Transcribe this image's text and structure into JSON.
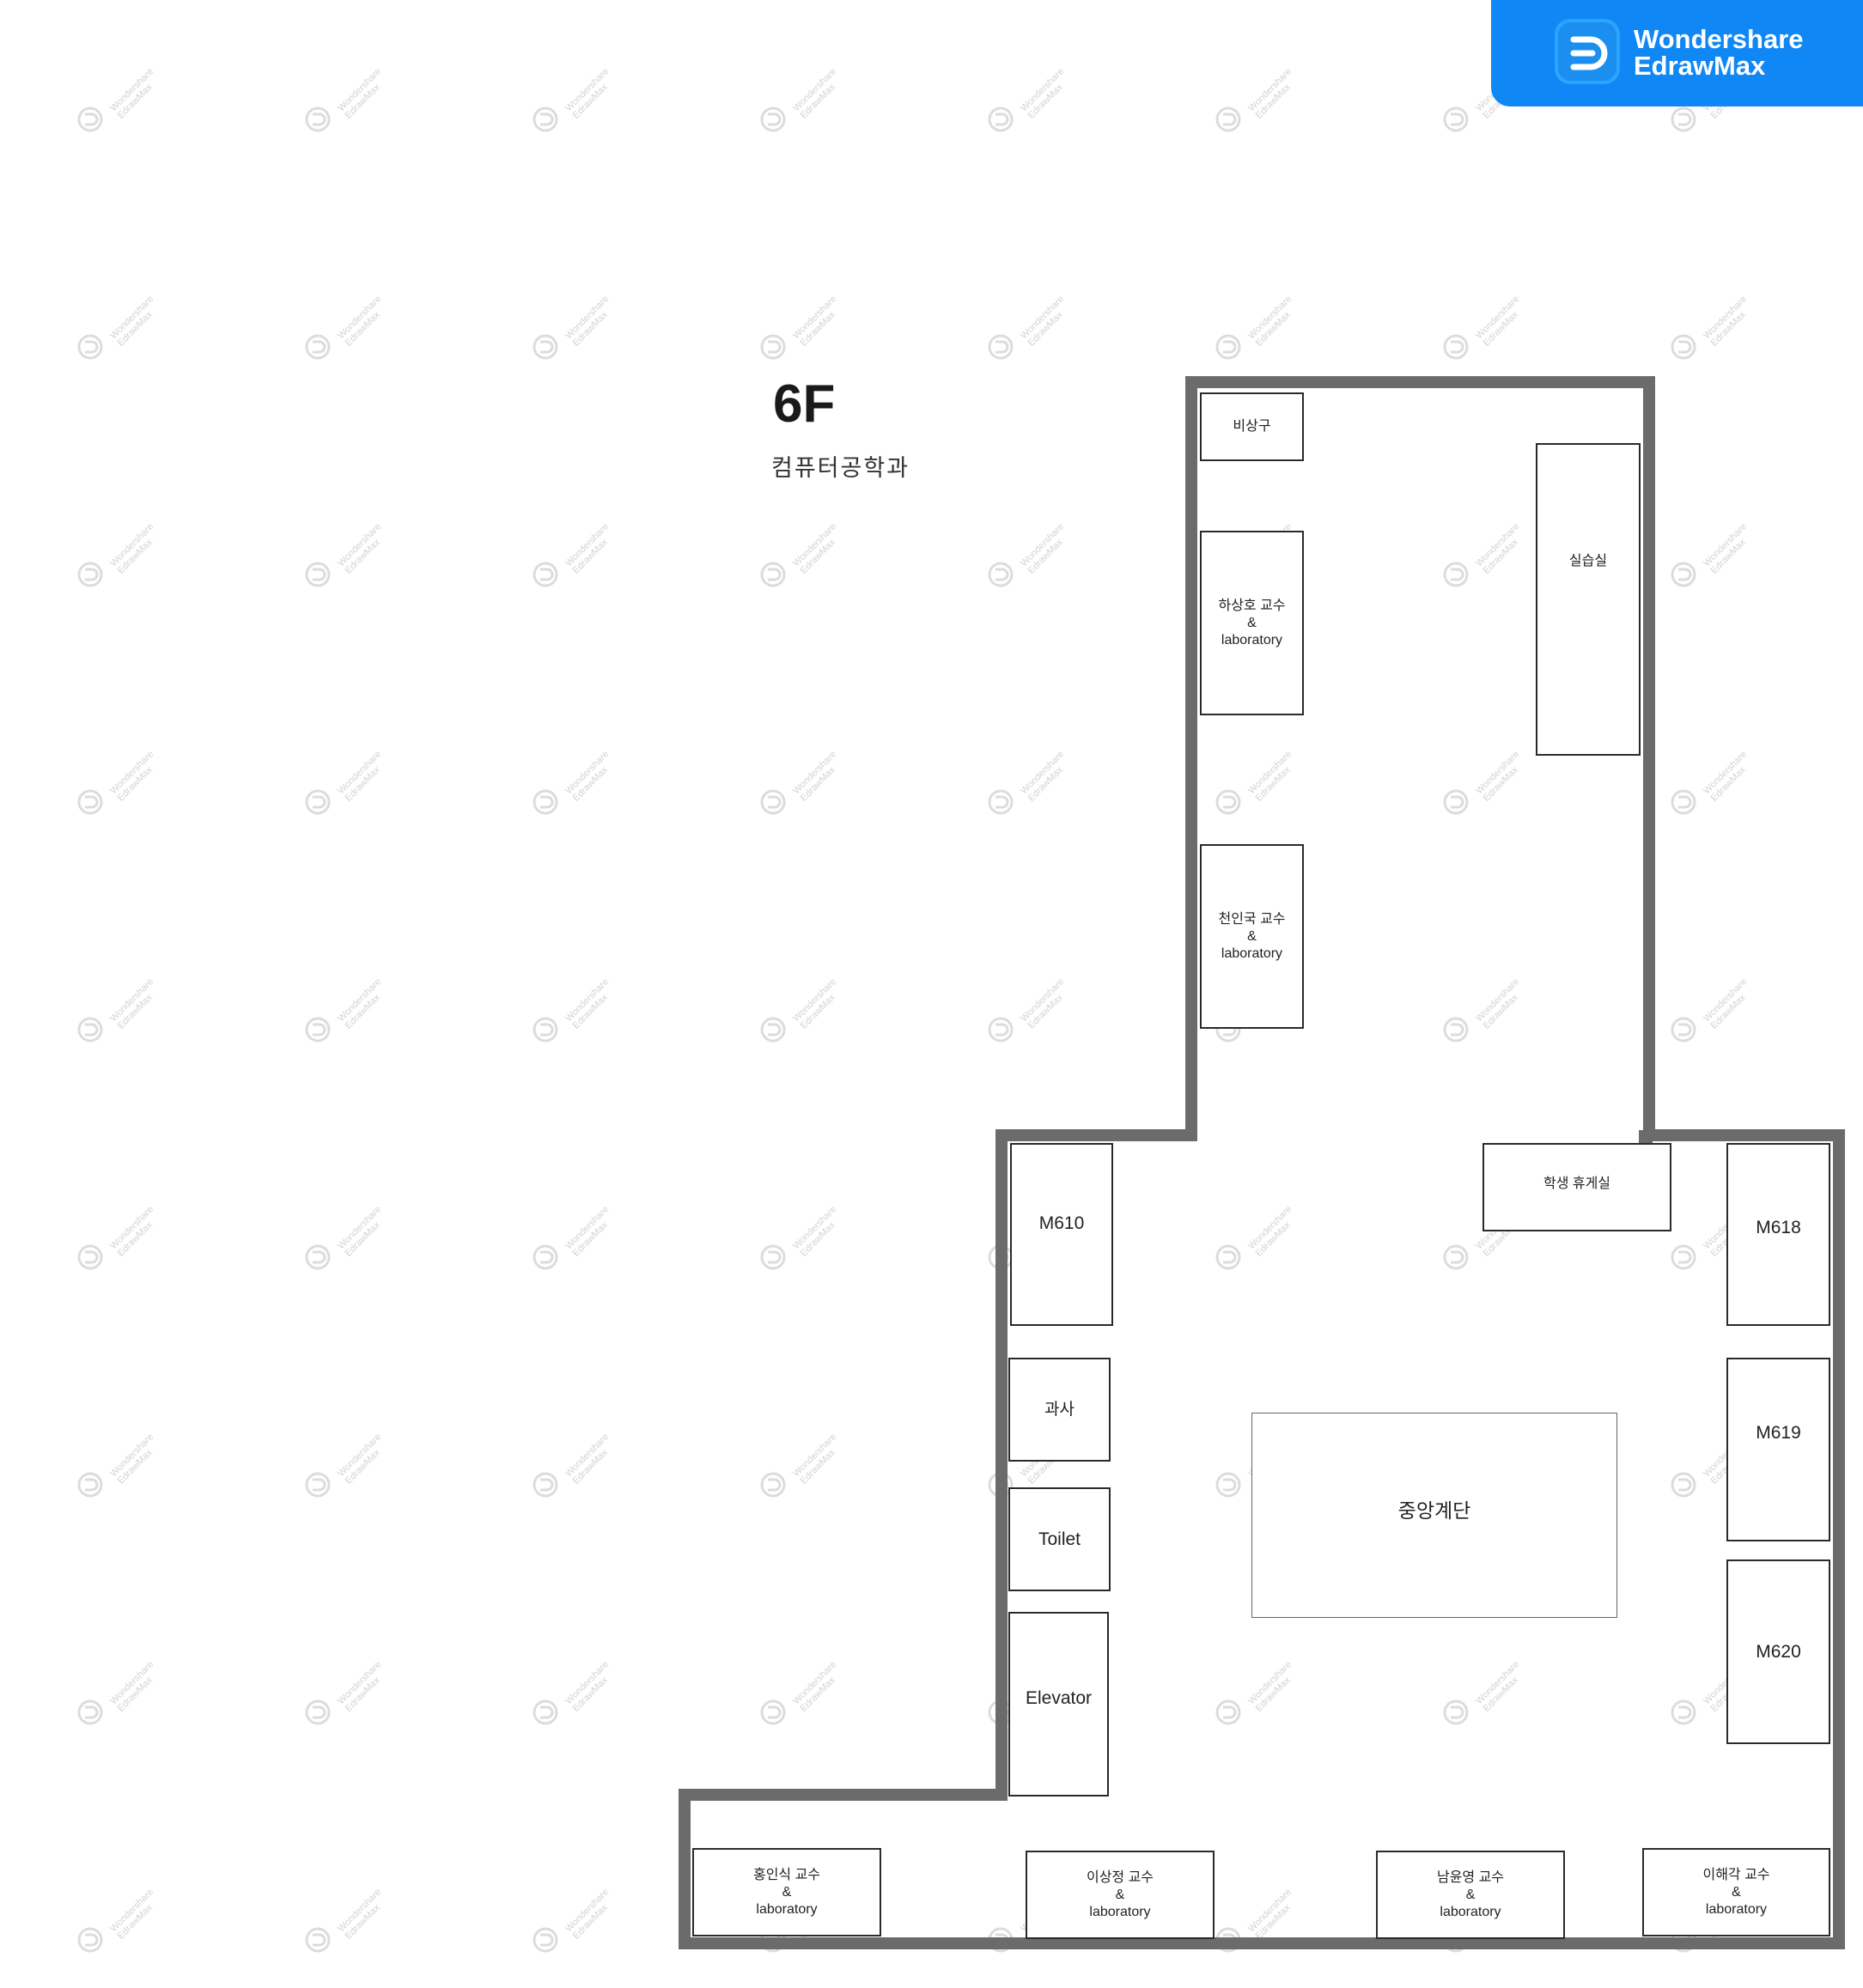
{
  "brand": {
    "line1": "Wondershare",
    "line2": "EdrawMax",
    "color": "#0f87f5"
  },
  "watermark": {
    "line1": "Wondershare",
    "line2": "EdrawMax"
  },
  "floor_label": "6F",
  "department": "컴퓨터공학과",
  "rooms": {
    "emergency_exit": "비상구",
    "ha_lab": {
      "name": "하상호 교수",
      "amp": "&",
      "lab": "laboratory"
    },
    "practice_room": "실습실",
    "cheon_lab": {
      "name": "천인국 교수",
      "amp": "&",
      "lab": "laboratory"
    },
    "m610": "M610",
    "student_lounge": "학생 휴게실",
    "m618": "M618",
    "office": "과사",
    "m619": "M619",
    "central_stairs": "중앙계단",
    "toilet": "Toilet",
    "m620": "M620",
    "elevator": "Elevator",
    "hong_lab": {
      "name": "홍인식 교수",
      "amp": "&",
      "lab": "laboratory"
    },
    "lee_sj_lab": {
      "name": "이상정 교수",
      "amp": "&",
      "lab": "laboratory"
    },
    "nam_lab": {
      "name": "남윤영 교수",
      "amp": "&",
      "lab": "laboratory"
    },
    "lee_hg_lab": {
      "name": "이해각 교수",
      "amp": "&",
      "lab": "laboratory"
    }
  },
  "colors": {
    "wall": "#6b6b6b",
    "room_border": "#2a2a2a",
    "watermark": "#d3d3d3"
  }
}
